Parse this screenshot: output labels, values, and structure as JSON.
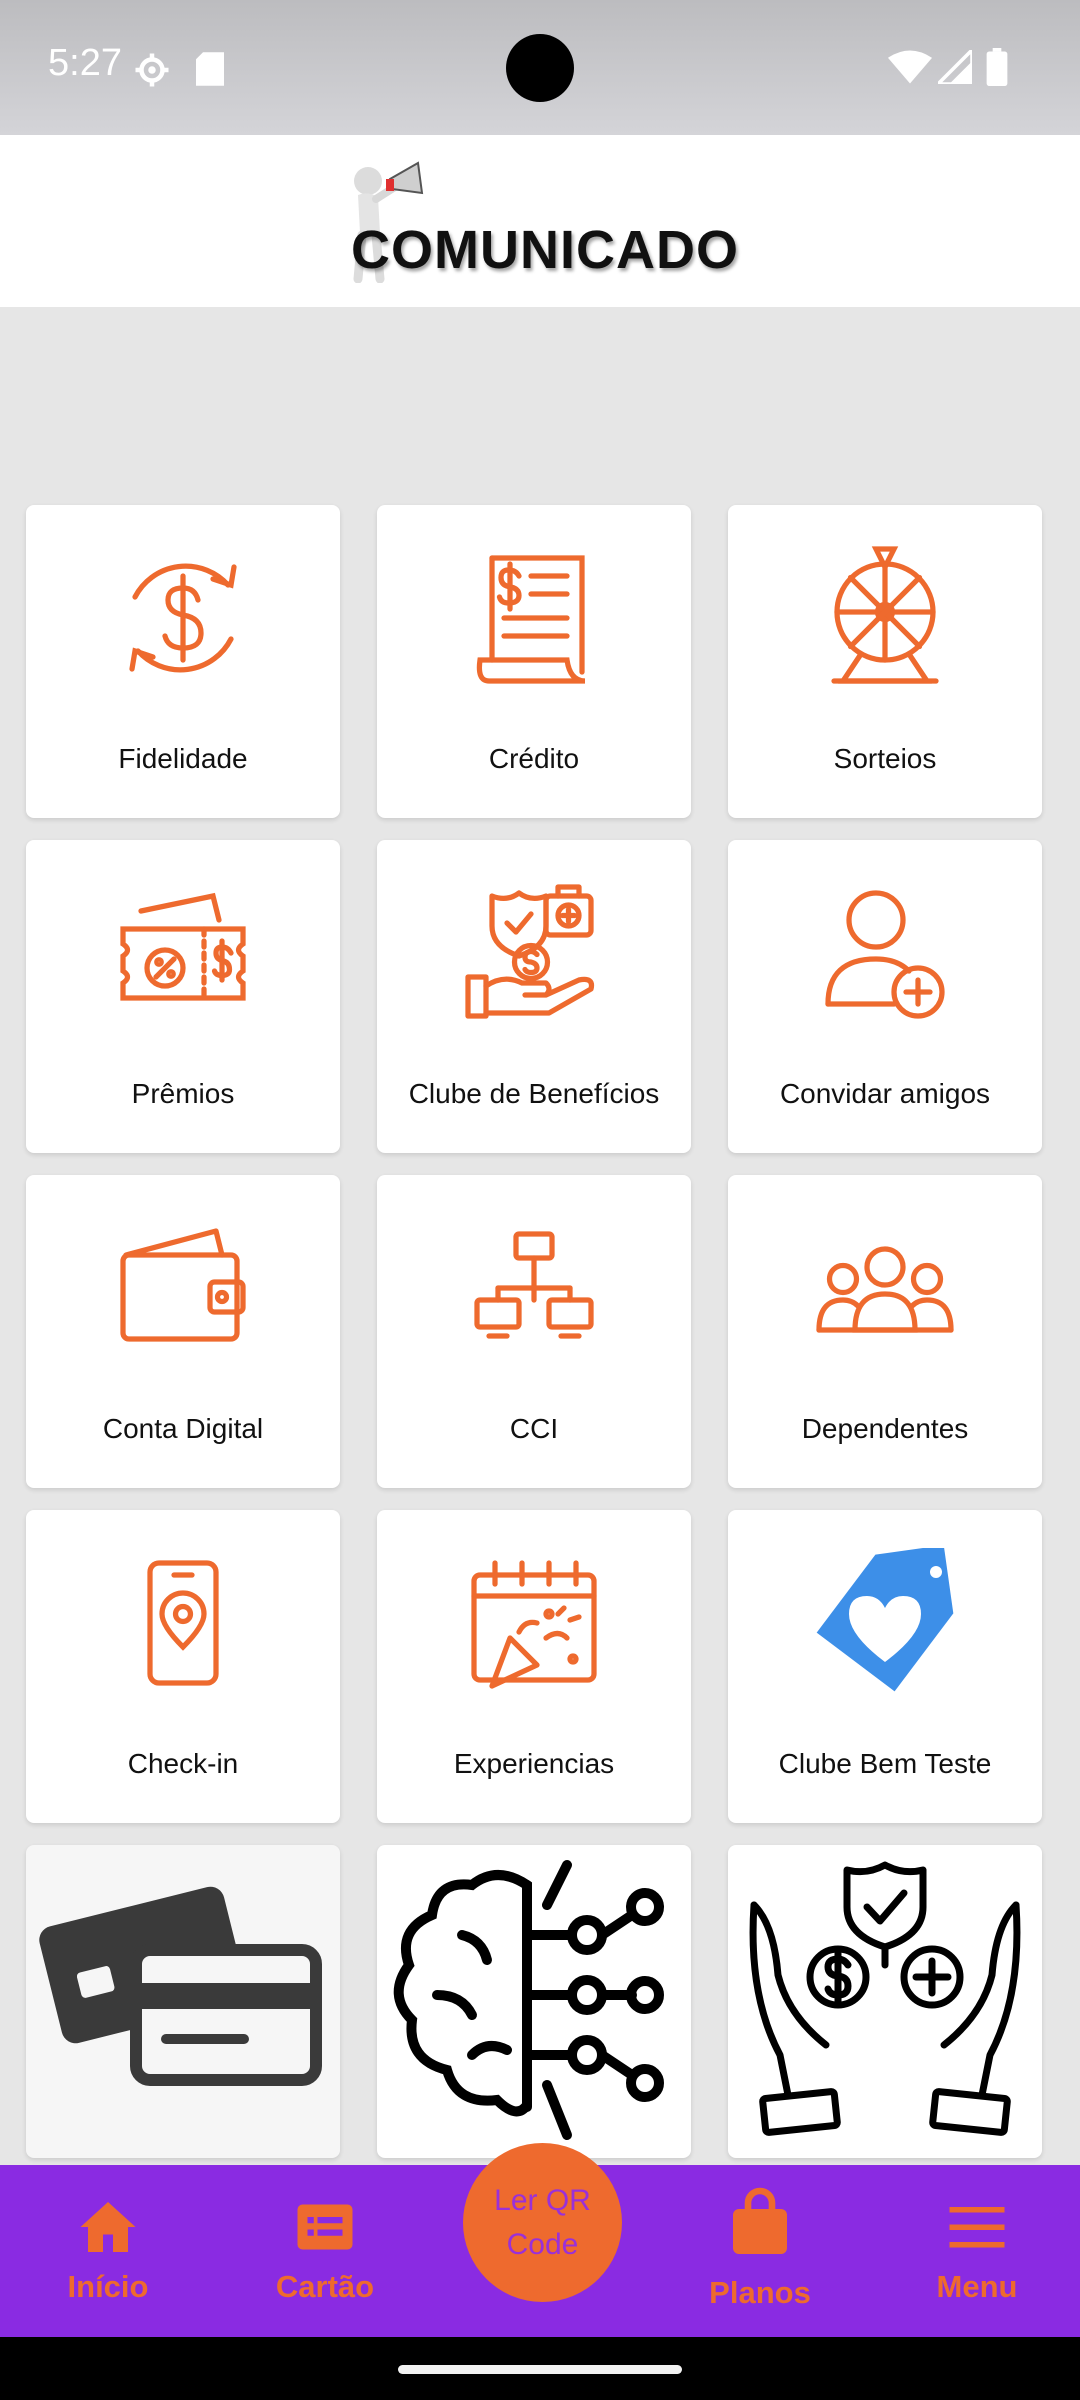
{
  "status_bar": {
    "time": "5:27"
  },
  "banner": {
    "title": "COMUNICADO"
  },
  "grid": {
    "items": [
      {
        "label": "Fidelidade",
        "icon": "dollar-refresh-icon"
      },
      {
        "label": "Crédito",
        "icon": "dollar-document-icon"
      },
      {
        "label": "Sorteios",
        "icon": "prize-wheel-icon"
      },
      {
        "label": "Prêmios",
        "icon": "voucher-tickets-icon"
      },
      {
        "label": "Clube de Benefícios",
        "icon": "benefits-hand-icon"
      },
      {
        "label": "Convidar amigos",
        "icon": "add-user-icon"
      },
      {
        "label": "Conta Digital",
        "icon": "wallet-icon"
      },
      {
        "label": "CCI",
        "icon": "network-icon"
      },
      {
        "label": "Dependentes",
        "icon": "group-icon"
      },
      {
        "label": "Check-in",
        "icon": "phone-location-icon"
      },
      {
        "label": "Experiencias",
        "icon": "calendar-party-icon"
      },
      {
        "label": "Clube Bem Teste",
        "icon": "heart-tag-icon"
      }
    ],
    "image_items": [
      {
        "icon": "credit-cards-icon"
      },
      {
        "icon": "brain-circuit-icon"
      },
      {
        "icon": "hands-dollar-shield-icon"
      }
    ]
  },
  "bottom_nav": {
    "items": [
      {
        "label": "Início",
        "icon": "home-icon"
      },
      {
        "label": "Cartão",
        "icon": "card-icon"
      },
      {
        "label": "Planos",
        "icon": "shopping-bag-icon"
      },
      {
        "label": "Menu",
        "icon": "hamburger-icon"
      }
    ],
    "qr": {
      "line1": "Ler QR",
      "line2": "Code"
    }
  },
  "colors": {
    "accent_orange": "#ee6a2e",
    "nav_purple": "#8a2be2",
    "heart_tag_blue": "#3d8fe8",
    "background": "#e6e6e6"
  }
}
